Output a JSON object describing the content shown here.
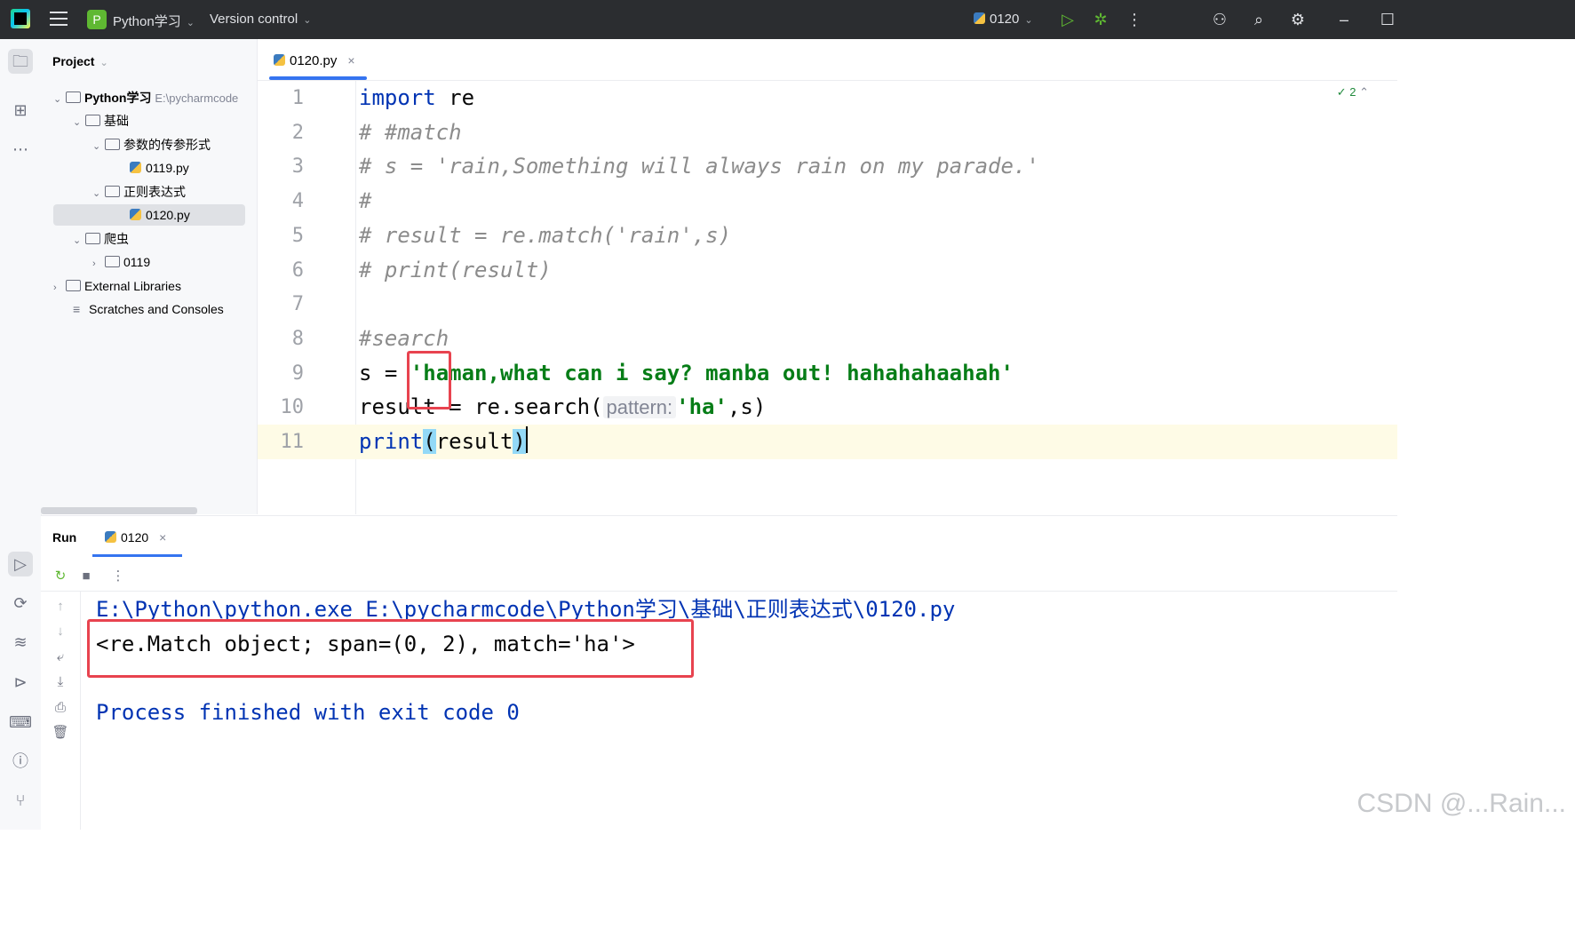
{
  "titlebar": {
    "project_badge": "P",
    "project_name": "Python学习",
    "vcs": "Version control",
    "run_config": "0120"
  },
  "project_panel": {
    "title": "Project",
    "tree": [
      {
        "label": "Python学习",
        "path": "E:\\pycharmcode",
        "depth": 0,
        "kind": "folder",
        "expanded": true
      },
      {
        "label": "基础",
        "depth": 1,
        "kind": "folder",
        "expanded": true
      },
      {
        "label": "参数的传参形式",
        "depth": 2,
        "kind": "folder",
        "expanded": true
      },
      {
        "label": "0119.py",
        "depth": 3,
        "kind": "python-file"
      },
      {
        "label": "正则表达式",
        "depth": 2,
        "kind": "folder",
        "expanded": true
      },
      {
        "label": "0120.py",
        "depth": 3,
        "kind": "python-file",
        "selected": true
      },
      {
        "label": "爬虫",
        "depth": 1,
        "kind": "folder",
        "expanded": true
      },
      {
        "label": "0119",
        "depth": 2,
        "kind": "folder",
        "expanded": false
      },
      {
        "label": "External Libraries",
        "depth": 0,
        "kind": "library",
        "expanded": false
      },
      {
        "label": "Scratches and Consoles",
        "depth": 0,
        "kind": "scratches"
      }
    ]
  },
  "editor": {
    "tab": "0120.py",
    "inspection_count": "2",
    "line_numbers": [
      "1",
      "2",
      "3",
      "4",
      "5",
      "6",
      "7",
      "8",
      "9",
      "10",
      "11"
    ],
    "lines": {
      "l1_kw": "import",
      "l1_rest": " re",
      "l2": "# #match",
      "l3": "# s = 'rain,Something will always rain on my parade.'",
      "l4": "#",
      "l5": "# result = re.match('rain',s)",
      "l6": "# print(result)",
      "l8": "#search",
      "l9_pre": "s = ",
      "l9_str": "'haman,what can i say? manba out! hahahahaahah'",
      "l10_pre": "result = re.search(",
      "l10_hint": "pattern:",
      "l10_str": "'ha'",
      "l10_post": ",s)",
      "l11_fn": "print",
      "l11_open": "(",
      "l11_arg": "result",
      "l11_close": ")"
    }
  },
  "run_panel": {
    "title": "Run",
    "tab": "0120",
    "console": {
      "command": "E:\\Python\\python.exe E:\\pycharmcode\\Python学习\\基础\\正则表达式\\0120.py",
      "output": "<re.Match object; span=(0, 2), match='ha'>",
      "exit": "Process finished with exit code 0"
    }
  },
  "watermark": "CSDN @...Rain...",
  "colors": {
    "titlebar_bg": "#2b2d30",
    "keyword": "#0033b3",
    "string": "#067d17",
    "comment": "#8c8c8c",
    "highlight_box": "#e8434f",
    "accent": "#3574f0"
  }
}
